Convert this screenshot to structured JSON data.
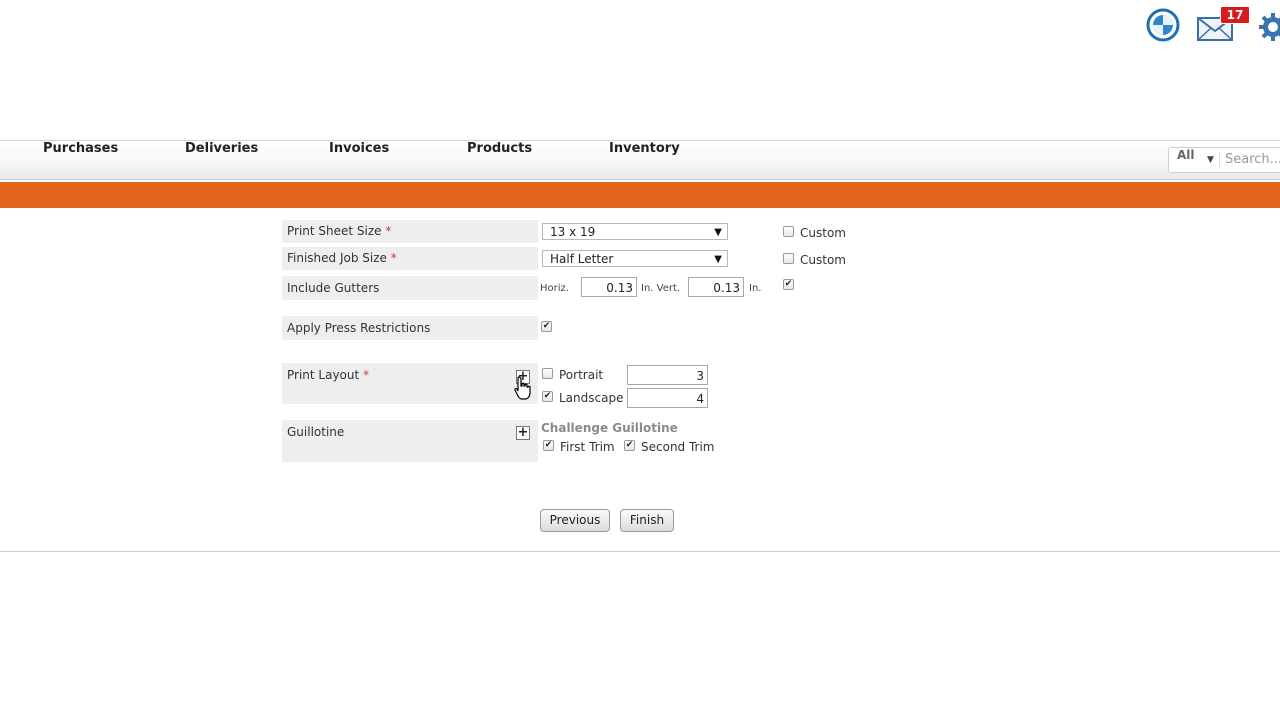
{
  "header": {
    "notification_count": "17",
    "icons": [
      "globe-help-icon",
      "mail-icon",
      "gear-icon"
    ]
  },
  "nav": {
    "items": [
      "Purchases",
      "Deliveries",
      "Invoices",
      "Products",
      "Inventory"
    ],
    "search_scope": "All",
    "search_placeholder": "Search..."
  },
  "form": {
    "print_sheet_size": {
      "label": "Print Sheet Size",
      "value": "13 x 19",
      "custom_label": "Custom",
      "custom_checked": false
    },
    "finished_job_size": {
      "label": "Finished Job Size",
      "value": "Half Letter",
      "custom_label": "Custom",
      "custom_checked": false
    },
    "include_gutters": {
      "label": "Include Gutters",
      "horiz_label": "Horiz.",
      "horiz_value": "0.13",
      "horiz_unit_vert_label": "In. Vert.",
      "vert_value": "0.13",
      "vert_unit": "In.",
      "checked": true
    },
    "apply_press_restrictions": {
      "label": "Apply Press Restrictions",
      "checked": true
    },
    "print_layout": {
      "label": "Print Layout",
      "portrait_label": "Portrait",
      "portrait_checked": false,
      "portrait_value": "3",
      "landscape_label": "Landscape",
      "landscape_checked": true,
      "landscape_value": "4"
    },
    "guillotine": {
      "label": "Guillotine",
      "section_title": "Challenge Guillotine",
      "first_trim_label": "First Trim",
      "first_trim_checked": true,
      "second_trim_label": "Second Trim",
      "second_trim_checked": true
    },
    "required_mark": "*"
  },
  "buttons": {
    "previous": "Previous",
    "finish": "Finish"
  },
  "colors": {
    "accent": "#e4661e",
    "required": "#d9322f",
    "badge": "#d71c1c"
  }
}
